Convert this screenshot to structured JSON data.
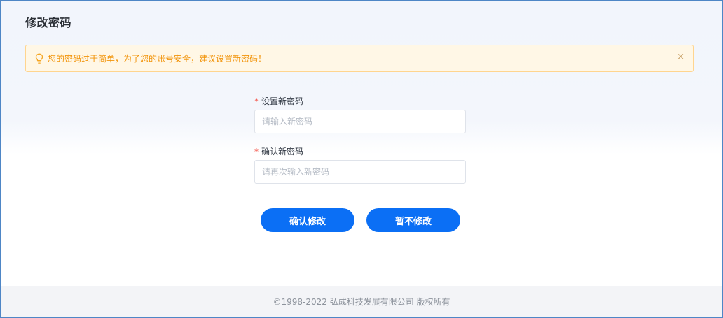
{
  "page": {
    "title": "修改密码"
  },
  "alert": {
    "icon": "lightbulb-icon",
    "message": "您的密码过于简单，为了您的账号安全，建议设置新密码！",
    "close_glyph": "×",
    "colors": {
      "background": "#fff7e6",
      "border": "#ffd58f",
      "text": "#f2940a"
    }
  },
  "form": {
    "new_password": {
      "required_mark": "*",
      "label": "设置新密码",
      "value": "",
      "placeholder": "请输入新密码"
    },
    "confirm_password": {
      "required_mark": "*",
      "label": "确认新密码",
      "value": "",
      "placeholder": "请再次输入新密码"
    }
  },
  "actions": {
    "confirm_label": "确认修改",
    "skip_label": "暂不修改",
    "accent_color": "#0b6ff5"
  },
  "footer": {
    "copyright": "©1998-2022 弘成科技发展有限公司 版权所有"
  }
}
